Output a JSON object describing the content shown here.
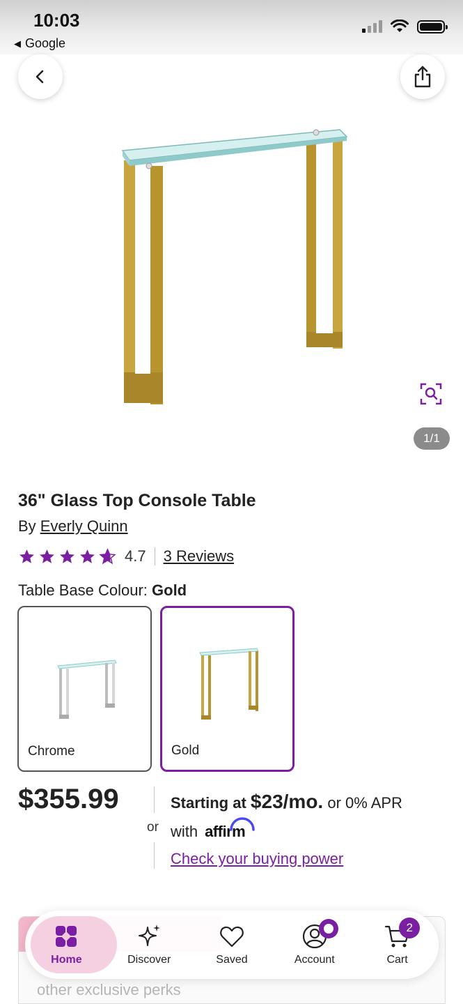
{
  "status_bar": {
    "time": "10:03",
    "back_app": "Google"
  },
  "icons": {
    "back": "chevron-left-icon",
    "share": "share-icon",
    "zoom": "visual-search-icon"
  },
  "gallery": {
    "counter": "1/1"
  },
  "product": {
    "title": "36\" Glass Top Console Table",
    "by_prefix": "By",
    "brand": "Everly Quinn",
    "rating": "4.7",
    "rating_fraction": 0.94,
    "reviews": "3 Reviews",
    "option_label": "Table Base Colour:",
    "option_selected": "Gold",
    "swatches": [
      {
        "label": "Chrome",
        "selected": false
      },
      {
        "label": "Gold",
        "selected": true
      }
    ],
    "price": "$355.99"
  },
  "financing": {
    "or": "or",
    "starting_at": "Starting at",
    "monthly": "$23/mo.",
    "apr": "or 0% APR",
    "with": "with",
    "provider": "affirm",
    "check_link": "Check your buying power"
  },
  "promo": {
    "text": "other exclusive perks"
  },
  "nav": {
    "items": [
      {
        "label": "Home",
        "icon": "home-icon",
        "active": true
      },
      {
        "label": "Discover",
        "icon": "sparkle-icon",
        "active": false
      },
      {
        "label": "Saved",
        "icon": "heart-icon",
        "active": false
      },
      {
        "label": "Account",
        "icon": "account-icon",
        "active": false
      },
      {
        "label": "Cart",
        "icon": "cart-icon",
        "active": false
      }
    ],
    "cart_count": "2"
  },
  "colors": {
    "accent": "#7b1fa2",
    "gold": "#c8a43c",
    "glass": "#bfe3e3"
  }
}
